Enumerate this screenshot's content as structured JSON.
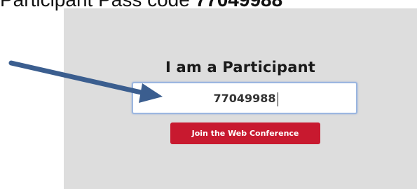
{
  "caption": {
    "prefix": "Participant Pass code ",
    "code": "77049988"
  },
  "participant_panel": {
    "heading": "I am a Participant",
    "code_input_value": "77049988",
    "join_button_label": "Join the Web Conference"
  },
  "annotation": {
    "arrow_color": "#3b5e8f",
    "arrow_icon": "pointer-arrow-icon"
  },
  "colors": {
    "panel_background": "#dddddd",
    "button_background": "#c8192f",
    "input_focus_border": "#9bb6e0"
  }
}
